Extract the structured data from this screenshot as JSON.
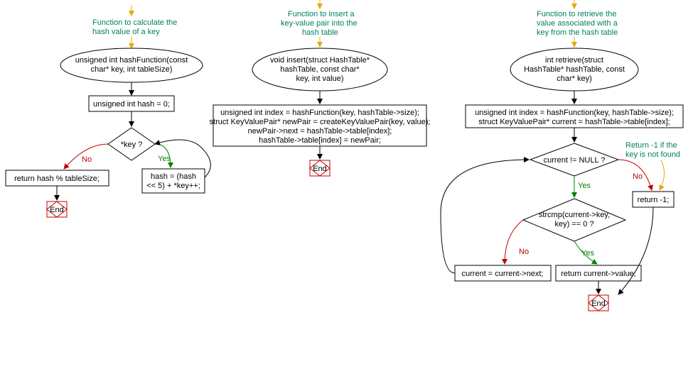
{
  "flow1": {
    "comment_line1": "Function to calculate the",
    "comment_line2": "hash value of a key",
    "signature_line1": "unsigned int hashFunction(const",
    "signature_line2": "char* key, int tableSize)",
    "init": "unsigned int hash = 0;",
    "cond": "*key ?",
    "yes_label": "Yes",
    "no_label": "No",
    "loop_body_line1": "hash = (hash",
    "loop_body_line2": "<< 5) + *key++;",
    "return_stmt": "return hash % tableSize;",
    "end": "End"
  },
  "flow2": {
    "comment_line1": "Function to insert a",
    "comment_line2": "key-value pair into the",
    "comment_line3": "hash table",
    "signature_line1": "void insert(struct HashTable*",
    "signature_line2": "hashTable, const char*",
    "signature_line3": "key, int value)",
    "body_line1": "unsigned int index = hashFunction(key, hashTable->size);",
    "body_line2": "struct KeyValuePair* newPair = createKeyValuePair(key, value);",
    "body_line3": "newPair->next = hashTable->table[index];",
    "body_line4": "hashTable->table[index] = newPair;",
    "end": "End"
  },
  "flow3": {
    "comment_line1": "Function to retrieve the",
    "comment_line2": "value associated with a",
    "comment_line3": "key from the hash table",
    "signature_line1": "int retrieve(struct",
    "signature_line2": "HashTable* hashTable, const",
    "signature_line3": "char* key)",
    "body_line1": "unsigned int index = hashFunction(key, hashTable->size);",
    "body_line2": "struct KeyValuePair* current = hashTable->table[index];",
    "cond1": "current != NULL ?",
    "yes_label": "Yes",
    "no_label": "No",
    "return_not_found": "return -1;",
    "not_found_comment_line1": "Return -1 if the",
    "not_found_comment_line2": "key is not found",
    "cond2_line1": "strcmp(current->key,",
    "cond2_line2": "key) == 0 ?",
    "return_found": "return current->value;",
    "advance": "current = current->next;",
    "end": "End"
  }
}
